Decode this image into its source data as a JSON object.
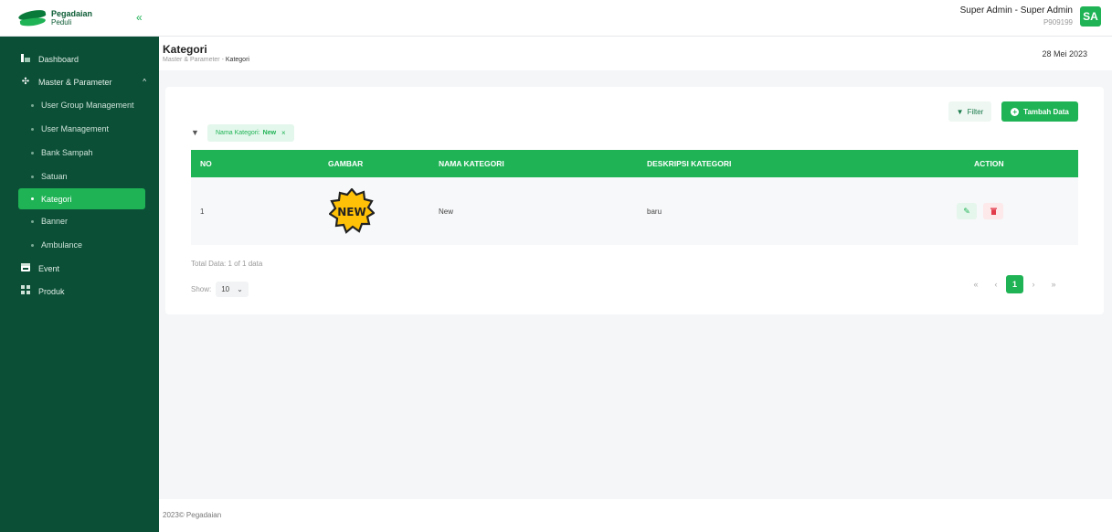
{
  "brand": {
    "name": "Pegadaian",
    "sub": "Peduli"
  },
  "user": {
    "name": "Super Admin - Super Admin",
    "id": "P909199",
    "initials": "SA"
  },
  "sidebar": {
    "items": [
      {
        "label": "Dashboard",
        "icon": "chart-icon"
      },
      {
        "label": "Master & Parameter",
        "icon": "settings-icon"
      }
    ],
    "sub_items": [
      {
        "label": "User Group Management"
      },
      {
        "label": "User Management"
      },
      {
        "label": "Bank Sampah"
      },
      {
        "label": "Satuan"
      },
      {
        "label": "Kategori"
      },
      {
        "label": "Banner"
      },
      {
        "label": "Ambulance"
      }
    ],
    "bottom_items": [
      {
        "label": "Event",
        "icon": "calendar-icon"
      },
      {
        "label": "Produk",
        "icon": "grid-icon"
      }
    ]
  },
  "header": {
    "title": "Kategori",
    "breadcrumb_parent": "Master & Parameter",
    "breadcrumb_sep": "-",
    "breadcrumb_current": "Kategori",
    "date": "28 Mei 2023"
  },
  "toolbar": {
    "filter_label": "Filter",
    "add_label": "Tambah Data"
  },
  "filter_chip": {
    "key": "Nama Kategori:",
    "value": "New",
    "close": "×"
  },
  "table": {
    "headers": [
      "NO",
      "GAMBAR",
      "NAMA KATEGORI",
      "DESKRIPSI KATEGORI",
      "ACTION"
    ],
    "rows": [
      {
        "no": "1",
        "image_text": "NEW",
        "nama": "New",
        "deskripsi": "baru"
      }
    ]
  },
  "total_text": "Total Data: 1 of 1 data",
  "show": {
    "label": "Show:",
    "value": "10"
  },
  "pagination": {
    "first": "«",
    "prev": "‹",
    "current": "1",
    "next": "›",
    "last": "»"
  },
  "footer": {
    "text": "2023© Pegadaian"
  },
  "colors": {
    "primary": "#1fb355",
    "sidebar": "#0a4f36",
    "danger": "#e23b4a"
  }
}
